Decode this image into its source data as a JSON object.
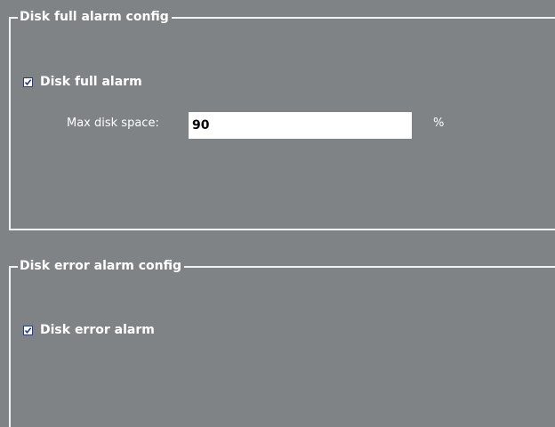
{
  "disk_full_group": {
    "legend": "Disk full alarm config",
    "checkbox_label": "Disk full alarm",
    "checked": true,
    "max_disk_space_label": "Max disk space:",
    "max_disk_space_value": "90",
    "unit": "%"
  },
  "disk_error_group": {
    "legend": "Disk error alarm config",
    "checkbox_label": "Disk error alarm",
    "checked": true
  },
  "colors": {
    "background": "#7f8385",
    "border": "#f2f2f2",
    "text": "#ffffff",
    "input_bg": "#ffffff",
    "checkmark": "#2a3d9e"
  }
}
